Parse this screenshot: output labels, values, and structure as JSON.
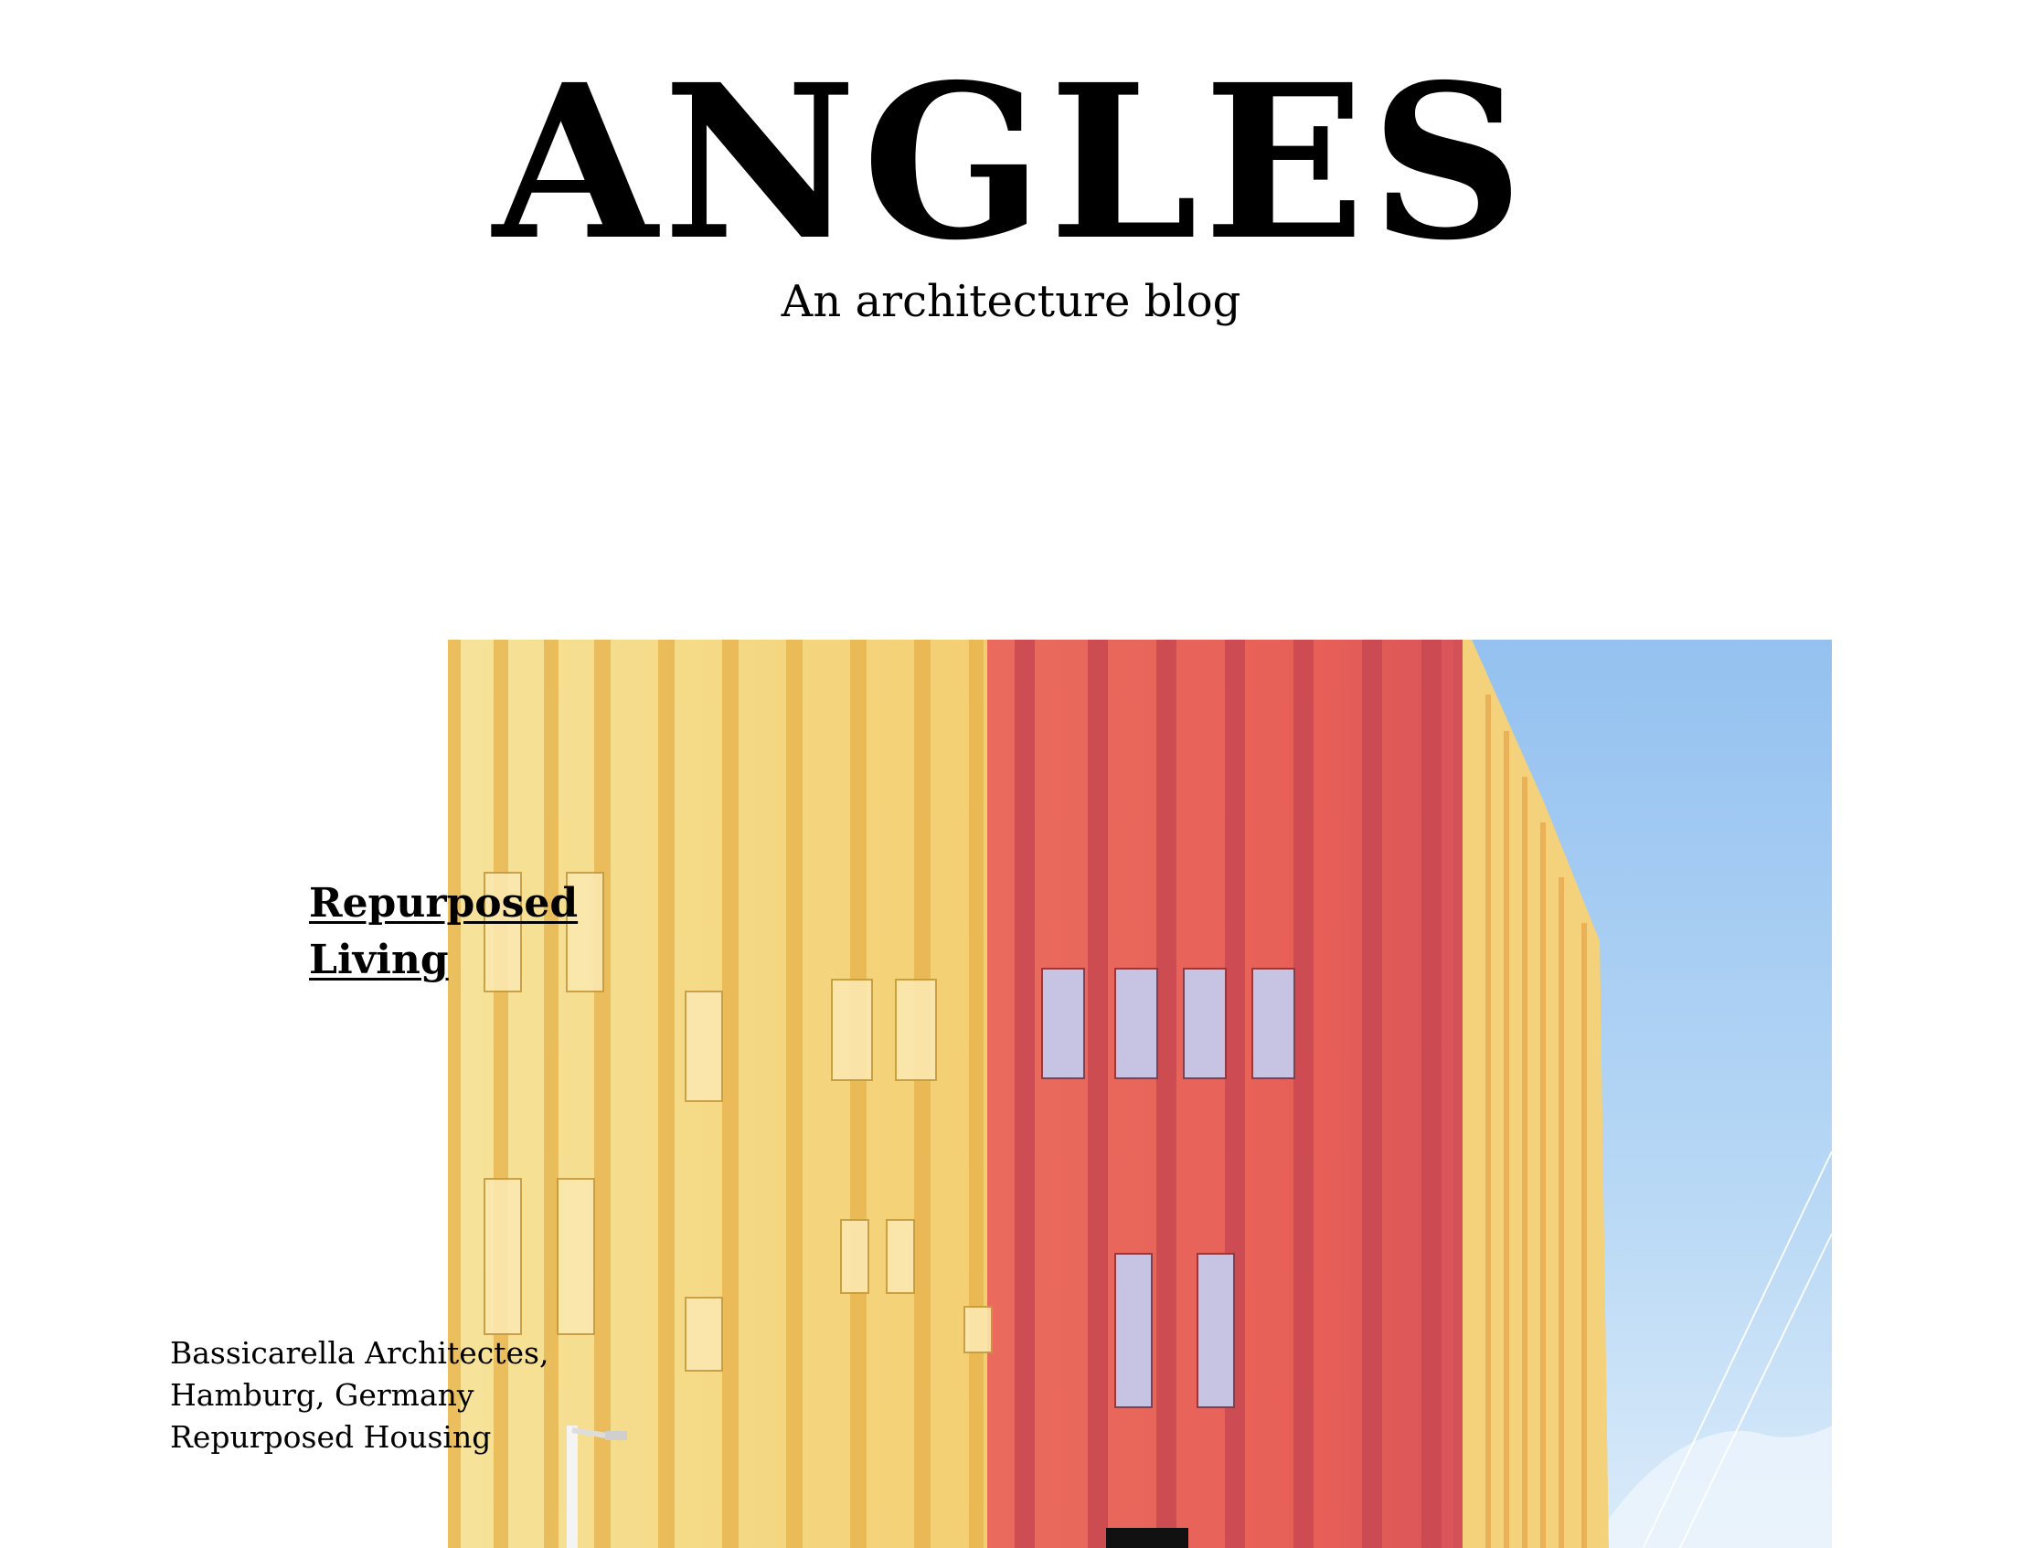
{
  "site": {
    "logo_text": "ANGLES",
    "tagline": "An architecture blog"
  },
  "featured_post": {
    "title_lines": [
      "Repurposed",
      "Living"
    ],
    "meta_lines": [
      "Bassicarella Architectes,",
      "Hamburg, Germany",
      "Repurposed Housing"
    ]
  },
  "colors": {
    "background": "#ffffff",
    "text": "#000000",
    "facade_yellow": "#f2c866",
    "facade_red": "#e75f57",
    "sky": "#a9cdf3"
  }
}
